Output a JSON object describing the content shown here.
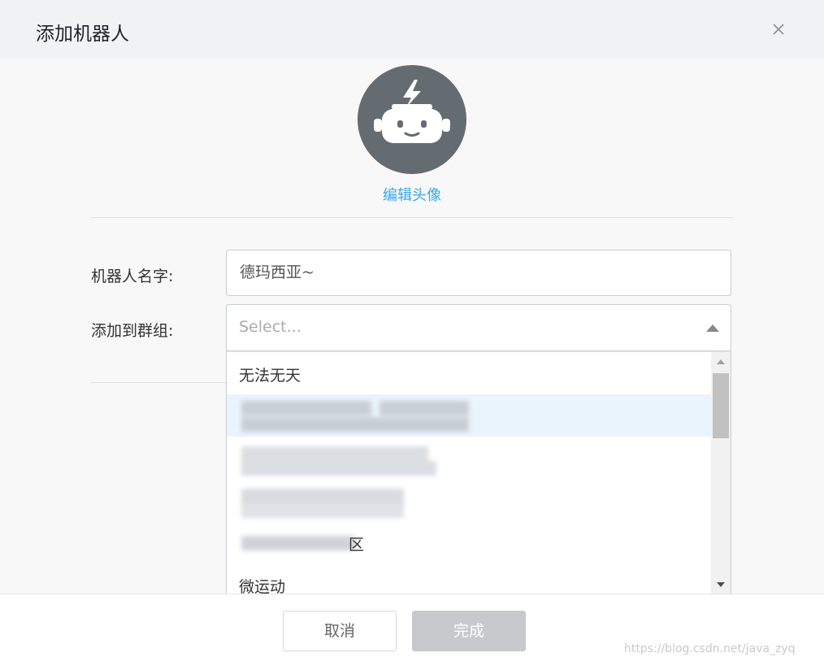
{
  "dialog": {
    "title": "添加机器人",
    "close_icon": "close-icon"
  },
  "avatar": {
    "icon": "robot-icon",
    "background_color": "#646b71",
    "edit_label": "编辑头像"
  },
  "form": {
    "name_label": "机器人名字:",
    "name_value": "德玛西亚~",
    "group_label": "添加到群组:",
    "group_placeholder": "Select...",
    "group_options": [
      "无法无天",
      "",
      "",
      "",
      "区",
      "微运动"
    ]
  },
  "footer": {
    "cancel_label": "取消",
    "done_label": "完成"
  },
  "watermark": "https://blog.csdn.net/java_zyq",
  "colors": {
    "accent": "#3aa7e8",
    "highlight_row": "#eaf4fc",
    "done_button": "#c8c9cd"
  }
}
